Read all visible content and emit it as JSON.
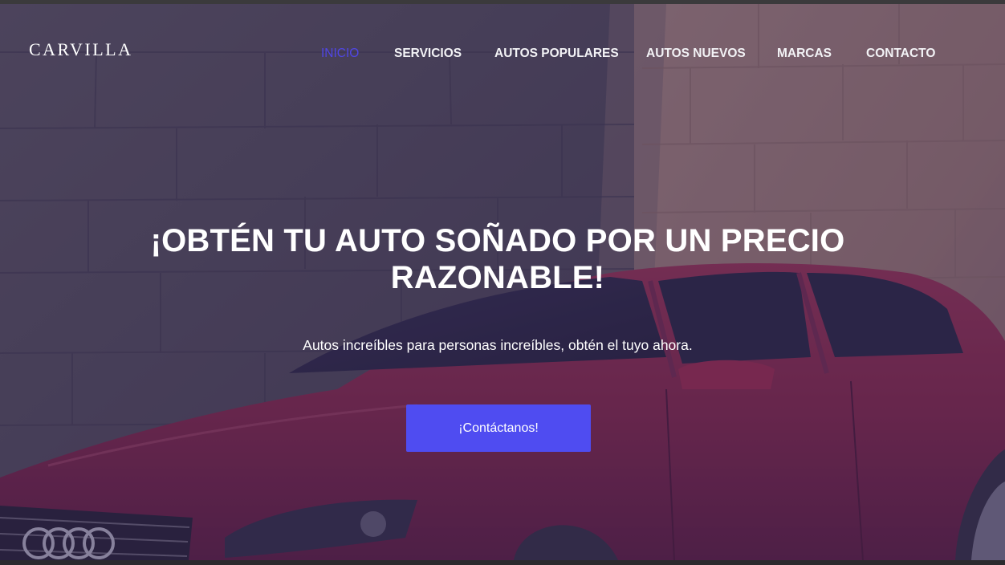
{
  "brand": {
    "logo_text": "CARVILLA"
  },
  "nav": {
    "items": [
      {
        "label": "INICIO",
        "active": true
      },
      {
        "label": "SERVICIOS",
        "active": false
      },
      {
        "label": "AUTOS POPULARES",
        "active": false
      },
      {
        "label": "AUTOS NUEVOS",
        "active": false
      },
      {
        "label": "MARCAS",
        "active": false
      },
      {
        "label": "CONTACTO",
        "active": false
      }
    ]
  },
  "hero": {
    "headline_line1": "¡OBTÉN TU AUTO SOÑADO POR UN PRECIO",
    "headline_line2": "RAZONABLE!",
    "subtitle": "Autos increíbles para personas increíbles, obtén el tuyo ahora.",
    "cta_label": "¡Contáctanos!",
    "background_image": "red-audi-sedan-stone-wall"
  },
  "colors": {
    "accent": "#5046e5",
    "button": "#4f4cf1",
    "text": "#ffffff"
  }
}
